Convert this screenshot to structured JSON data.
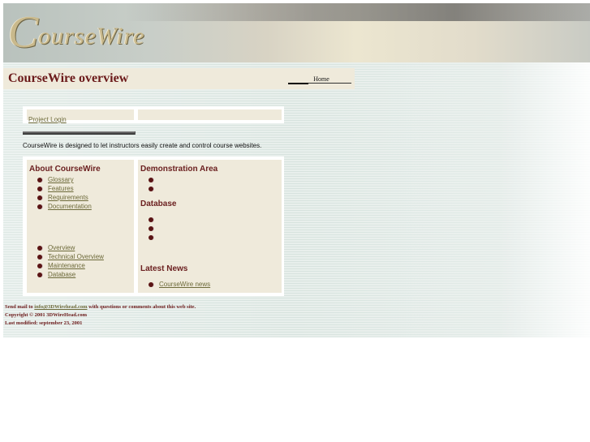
{
  "banner": {
    "logo_text": "CourseWire"
  },
  "header": {
    "title": "CourseWire overview",
    "home_link": "Home"
  },
  "login": {
    "project_login": "Project Login"
  },
  "intro": "CourseWire is designed to let instructors easily create and control course websites.",
  "about": {
    "heading": "About CourseWire",
    "links_a": [
      "Glossary",
      "Features",
      "Requirements",
      "Documentation"
    ],
    "links_b": [
      "Overview",
      "Technical Overview",
      "Maintenance",
      "Database"
    ]
  },
  "demo": {
    "heading": "Demonstration Area"
  },
  "database": {
    "heading": "Database"
  },
  "news": {
    "heading": "Latest News",
    "link": "CourseWire news"
  },
  "footer": {
    "mail_prefix": "Send mail to",
    "email": "info@3DWirehead.com",
    "mail_suffix": "with questions or comments about this web site.",
    "copyright": "Copyright © 2001 3DWireHead.com",
    "modified": "Last modified: september 23, 2001"
  },
  "colors": {
    "accent": "#6b1a1a",
    "panel": "#efeadb",
    "link": "#6d6a3a"
  }
}
